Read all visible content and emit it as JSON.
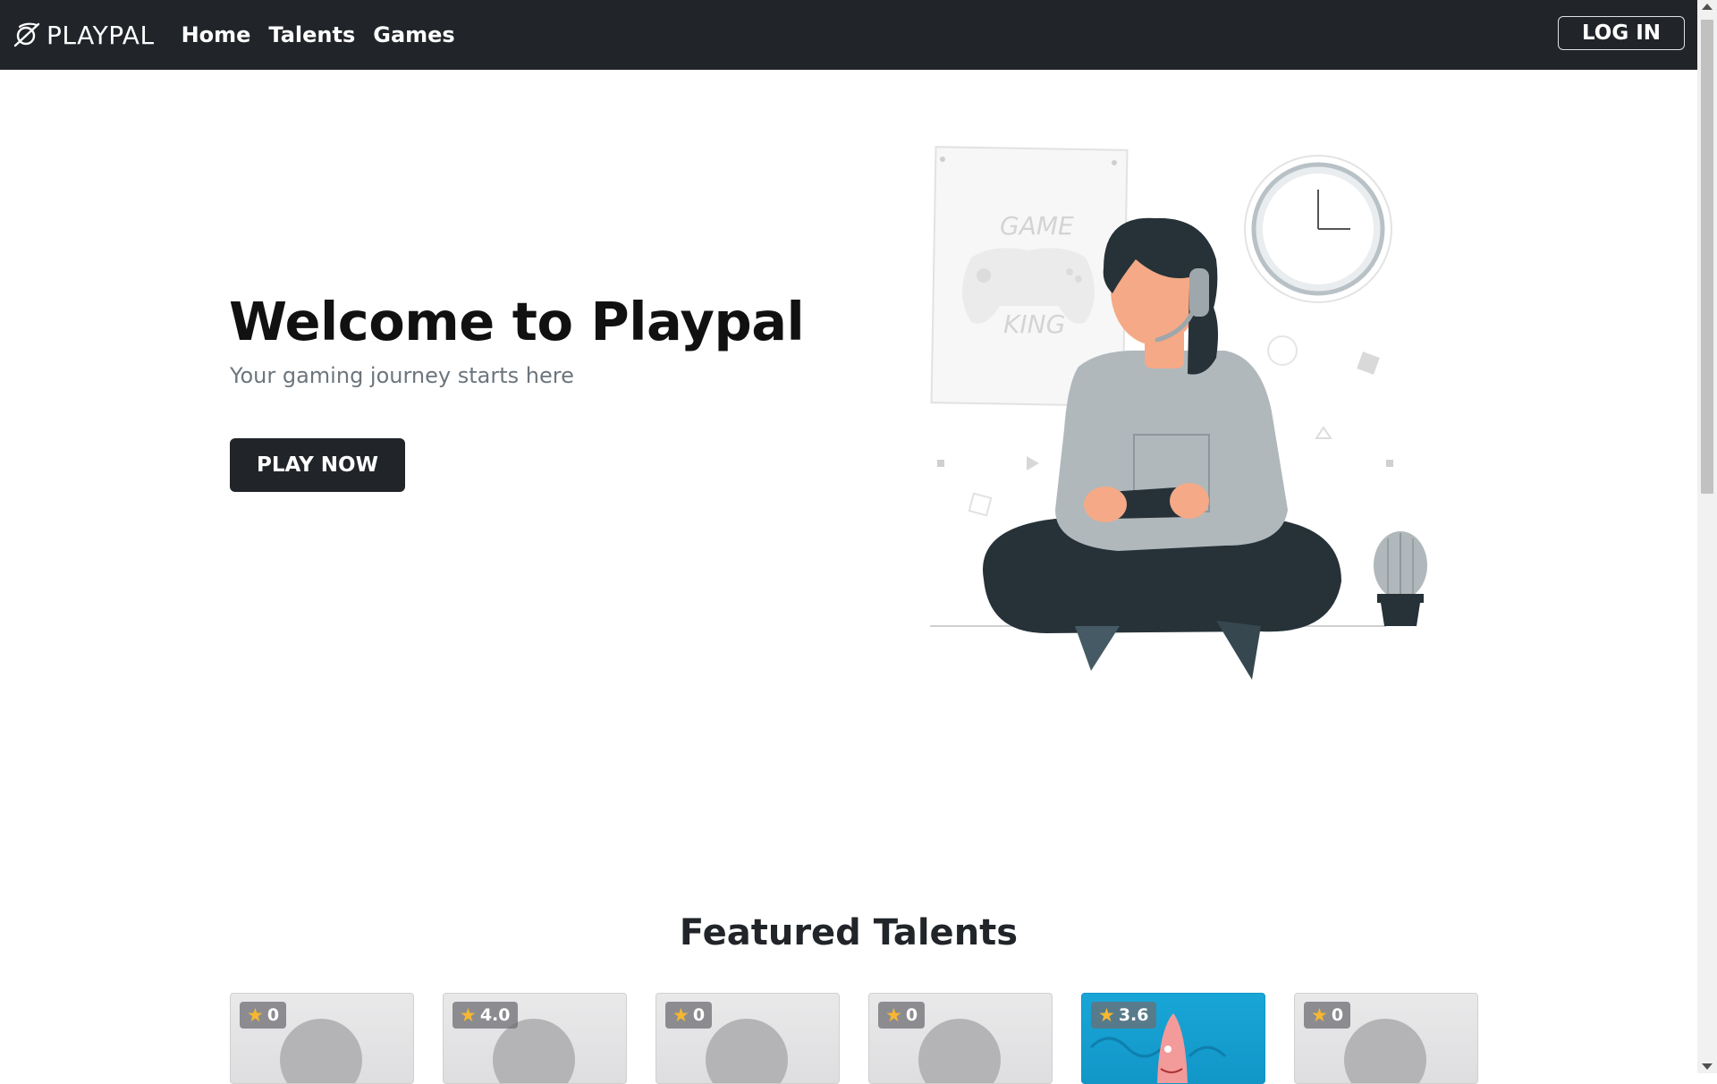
{
  "nav": {
    "brand": "PLAYPAL",
    "brand_icon": "planet-icon",
    "links": [
      "Home",
      "Talents",
      "Games"
    ],
    "login": "LOG IN"
  },
  "hero": {
    "title": "Welcome to Playpal",
    "subtitle": "Your gaming journey starts here",
    "cta": "PLAY NOW",
    "poster_line1": "GAME",
    "poster_line2": "KING"
  },
  "featured": {
    "title": "Featured Talents",
    "cards": [
      {
        "rating": "0"
      },
      {
        "rating": "4.0"
      },
      {
        "rating": "0"
      },
      {
        "rating": "0"
      },
      {
        "rating": "3.6"
      },
      {
        "rating": "0"
      }
    ]
  },
  "colors": {
    "navbar": "#212529",
    "button": "#212529",
    "star": "#f7b731",
    "subtitle": "#6c757d"
  }
}
